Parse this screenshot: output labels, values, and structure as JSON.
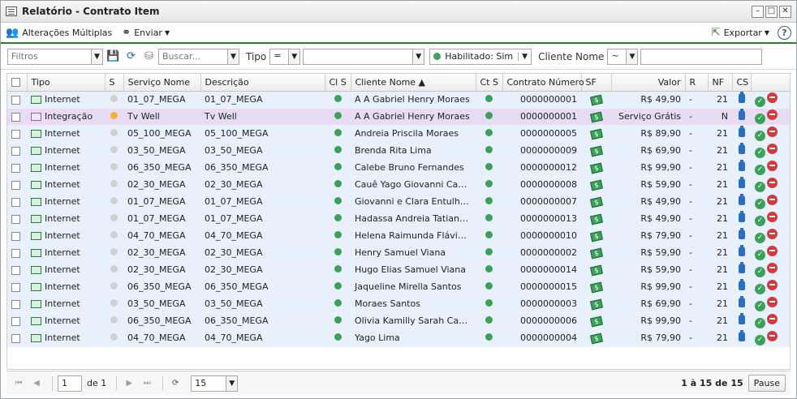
{
  "window": {
    "title": "Relatório - Contrato Item"
  },
  "toolbar": {
    "bulk_edit": "Alterações Múltiplas",
    "send": "Enviar",
    "export": "Exportar",
    "help": "?"
  },
  "filters": {
    "filter_placeholder": "Filtros",
    "search_placeholder": "Buscar...",
    "type_label": "Tipo",
    "type_operator": "=",
    "enabled": "Habilitado: Sim",
    "client_label": "Cliente Nome",
    "client_operator": "~"
  },
  "columns": {
    "tipo": "Tipo",
    "s": "S",
    "servico": "Serviço Nome",
    "descricao": "Descrição",
    "cls": "Cl S",
    "cliente": "Cliente Nome ▲",
    "cts": "Ct S",
    "contrato": "Contrato Número",
    "sf": "SF",
    "valor": "Valor",
    "r": "R",
    "nf": "NF",
    "cs": "CS"
  },
  "rows": [
    {
      "tipo": "Internet",
      "s": "grey",
      "servico": "01_07_MEGA",
      "descricao": "01_07_MEGA",
      "cliente": "A A Gabriel Henry Moraes",
      "contrato": "0000000001",
      "valor": "R$ 49,90",
      "r": "-",
      "nf": "21"
    },
    {
      "tipo": "Integração",
      "s": "orange",
      "servico": "Tv Well",
      "descricao": "Tv Well",
      "cliente": "A A Gabriel Henry Moraes",
      "contrato": "0000000001",
      "valor": "Serviço Grátis",
      "r": "-",
      "nf": "N"
    },
    {
      "tipo": "Internet",
      "s": "grey",
      "servico": "05_100_MEGA",
      "descricao": "05_100_MEGA",
      "cliente": "Andreia Priscila Moraes",
      "contrato": "0000000005",
      "valor": "R$ 89,90",
      "r": "-",
      "nf": "21"
    },
    {
      "tipo": "Internet",
      "s": "grey",
      "servico": "03_50_MEGA",
      "descricao": "03_50_MEGA",
      "cliente": "Brenda Rita Lima",
      "contrato": "0000000009",
      "valor": "R$ 69,90",
      "r": "-",
      "nf": "21"
    },
    {
      "tipo": "Internet",
      "s": "grey",
      "servico": "06_350_MEGA",
      "descricao": "06_350_MEGA",
      "cliente": "Calebe Bruno Fernandes",
      "contrato": "0000000012",
      "valor": "R$ 99,90",
      "r": "-",
      "nf": "21"
    },
    {
      "tipo": "Internet",
      "s": "grey",
      "servico": "02_30_MEGA",
      "descricao": "02_30_MEGA",
      "cliente": "Cauê Yago Giovanni Cavalca...",
      "contrato": "0000000008",
      "valor": "R$ 59,90",
      "r": "-",
      "nf": "21"
    },
    {
      "tipo": "Internet",
      "s": "grey",
      "servico": "01_07_MEGA",
      "descricao": "01_07_MEGA",
      "cliente": "Giovanni e Clara Entulhos ME",
      "contrato": "0000000007",
      "valor": "R$ 49,90",
      "r": "-",
      "nf": "21"
    },
    {
      "tipo": "Internet",
      "s": "grey",
      "servico": "01_07_MEGA",
      "descricao": "01_07_MEGA",
      "cliente": "Hadassa Andreia Tatiane da ...",
      "contrato": "0000000013",
      "valor": "R$ 49,90",
      "r": "-",
      "nf": "21"
    },
    {
      "tipo": "Internet",
      "s": "grey",
      "servico": "04_70_MEGA",
      "descricao": "04_70_MEGA",
      "cliente": "Helena Raimunda Flávia da ...",
      "contrato": "0000000010",
      "valor": "R$ 79,90",
      "r": "-",
      "nf": "21"
    },
    {
      "tipo": "Internet",
      "s": "grey",
      "servico": "02_30_MEGA",
      "descricao": "02_30_MEGA",
      "cliente": "Henry Samuel Viana",
      "contrato": "0000000002",
      "valor": "R$ 59,90",
      "r": "-",
      "nf": "21"
    },
    {
      "tipo": "Internet",
      "s": "grey",
      "servico": "02_30_MEGA",
      "descricao": "02_30_MEGA",
      "cliente": "Hugo Elias Samuel Viana",
      "contrato": "0000000014",
      "valor": "R$ 59,90",
      "r": "-",
      "nf": "21"
    },
    {
      "tipo": "Internet",
      "s": "grey",
      "servico": "06_350_MEGA",
      "descricao": "06_350_MEGA",
      "cliente": "Jaqueline Mirella Santos",
      "contrato": "0000000015",
      "valor": "R$ 99,90",
      "r": "-",
      "nf": "21"
    },
    {
      "tipo": "Internet",
      "s": "grey",
      "servico": "03_50_MEGA",
      "descricao": "03_50_MEGA",
      "cliente": "Moraes Santos",
      "contrato": "0000000003",
      "valor": "R$ 69,90",
      "r": "-",
      "nf": "21"
    },
    {
      "tipo": "Internet",
      "s": "grey",
      "servico": "06_350_MEGA",
      "descricao": "06_350_MEGA",
      "cliente": "Olivia Kamilly Sarah Castro",
      "contrato": "0000000006",
      "valor": "R$ 99,90",
      "r": "-",
      "nf": "21"
    },
    {
      "tipo": "Internet",
      "s": "grey",
      "servico": "04_70_MEGA",
      "descricao": "04_70_MEGA",
      "cliente": "Yago Lima",
      "contrato": "0000000004",
      "valor": "R$ 79,90",
      "r": "-",
      "nf": "21"
    }
  ],
  "pager": {
    "page": "1",
    "of": "de 1",
    "page_size": "15",
    "info": "1 à 15 de 15",
    "pause": "Pause"
  },
  "colors": {
    "accent": "#2f7d32",
    "row": "#e7f0fb",
    "row_highlight": "#e8dcf5"
  }
}
